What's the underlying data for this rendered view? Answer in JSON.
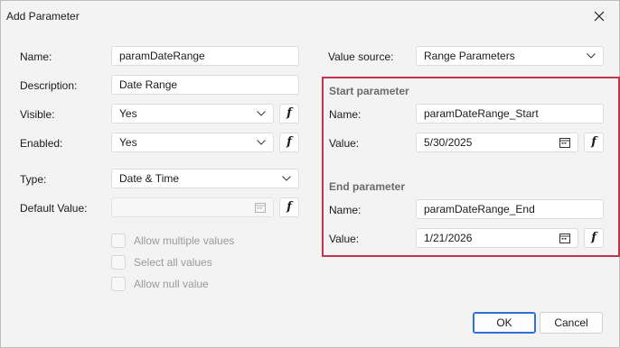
{
  "window": {
    "title": "Add Parameter"
  },
  "left": {
    "name": {
      "label": "Name:",
      "value": "paramDateRange"
    },
    "description": {
      "label": "Description:",
      "value": "Date Range"
    },
    "visible": {
      "label": "Visible:",
      "value": "Yes"
    },
    "enabled": {
      "label": "Enabled:",
      "value": "Yes"
    },
    "type": {
      "label": "Type:",
      "value": "Date & Time"
    },
    "default_value": {
      "label": "Default Value:",
      "value": ""
    },
    "checkboxes": [
      {
        "label": "Allow multiple values",
        "checked": false
      },
      {
        "label": "Select all values",
        "checked": false
      },
      {
        "label": "Allow null value",
        "checked": false
      }
    ]
  },
  "right": {
    "value_source": {
      "label": "Value source:",
      "value": "Range Parameters"
    },
    "start": {
      "title": "Start parameter",
      "name_label": "Name:",
      "name_value": "paramDateRange_Start",
      "value_label": "Value:",
      "value_value": "5/30/2025"
    },
    "end": {
      "title": "End parameter",
      "name_label": "Name:",
      "name_value": "paramDateRange_End",
      "value_label": "Value:",
      "value_value": "1/21/2026"
    }
  },
  "buttons": {
    "ok": "OK",
    "cancel": "Cancel"
  },
  "expression_button_glyph": "f",
  "icons": {
    "close": "close-icon",
    "dropdown": "chevron-down-icon",
    "calendar": "calendar-icon"
  },
  "colors": {
    "highlight_border": "#c0344d",
    "primary_button_border": "#2f6fd6"
  }
}
